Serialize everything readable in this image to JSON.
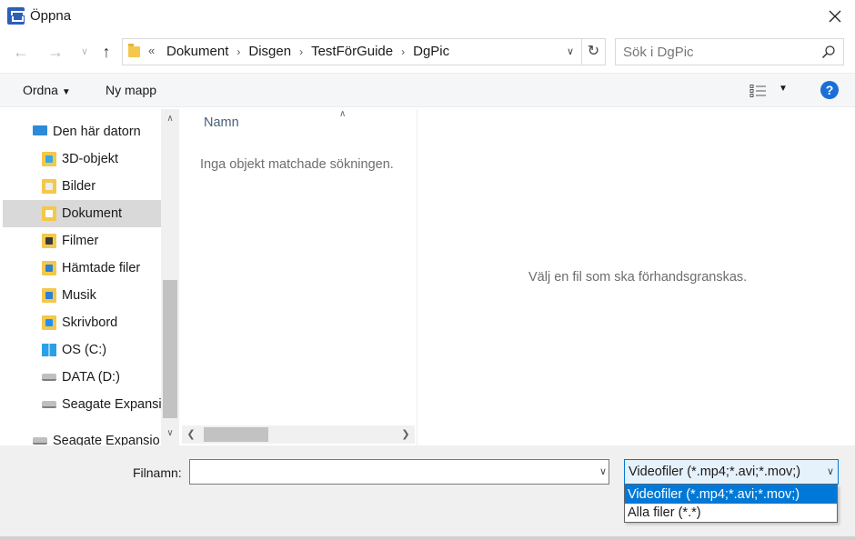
{
  "window": {
    "title": "Öppna"
  },
  "nav": {
    "breadcrumbs": [
      "Dokument",
      "Disgen",
      "TestFörGuide",
      "DgPic"
    ],
    "overflow_marker": "«"
  },
  "search": {
    "placeholder": "Sök i DgPic"
  },
  "toolbar": {
    "organize_label": "Ordna",
    "new_folder_label": "Ny mapp",
    "help": "?"
  },
  "sidebar": {
    "items": [
      {
        "label": "Den här datorn",
        "icon": "computer-icon"
      },
      {
        "label": "3D-objekt",
        "icon": "folder-3d-icon"
      },
      {
        "label": "Bilder",
        "icon": "folder-pictures-icon"
      },
      {
        "label": "Dokument",
        "icon": "folder-documents-icon",
        "selected": true
      },
      {
        "label": "Filmer",
        "icon": "folder-videos-icon"
      },
      {
        "label": "Hämtade filer",
        "icon": "folder-downloads-icon"
      },
      {
        "label": "Musik",
        "icon": "folder-music-icon"
      },
      {
        "label": "Skrivbord",
        "icon": "folder-desktop-icon"
      },
      {
        "label": "OS (C:)",
        "icon": "windows-drive-icon"
      },
      {
        "label": "DATA (D:)",
        "icon": "drive-icon"
      },
      {
        "label": "Seagate Expansi",
        "icon": "drive-icon"
      },
      {
        "label": "Seagate Expansio",
        "icon": "drive-icon"
      }
    ]
  },
  "filelist": {
    "column_name": "Namn",
    "empty_message": "Inga objekt matchade sökningen."
  },
  "preview": {
    "message": "Välj en fil som ska förhandsgranskas."
  },
  "footer": {
    "filename_label": "Filnamn:",
    "filename_value": "",
    "filter_selected": "Videofiler (*.mp4;*.avi;*.mov;)",
    "filter_options": [
      "Videofiler (*.mp4;*.avi;*.mov;)",
      "Alla filer (*.*)"
    ]
  },
  "colors": {
    "accent": "#0078d7",
    "selection": "#d9d9d9",
    "help": "#1a6fd6"
  }
}
